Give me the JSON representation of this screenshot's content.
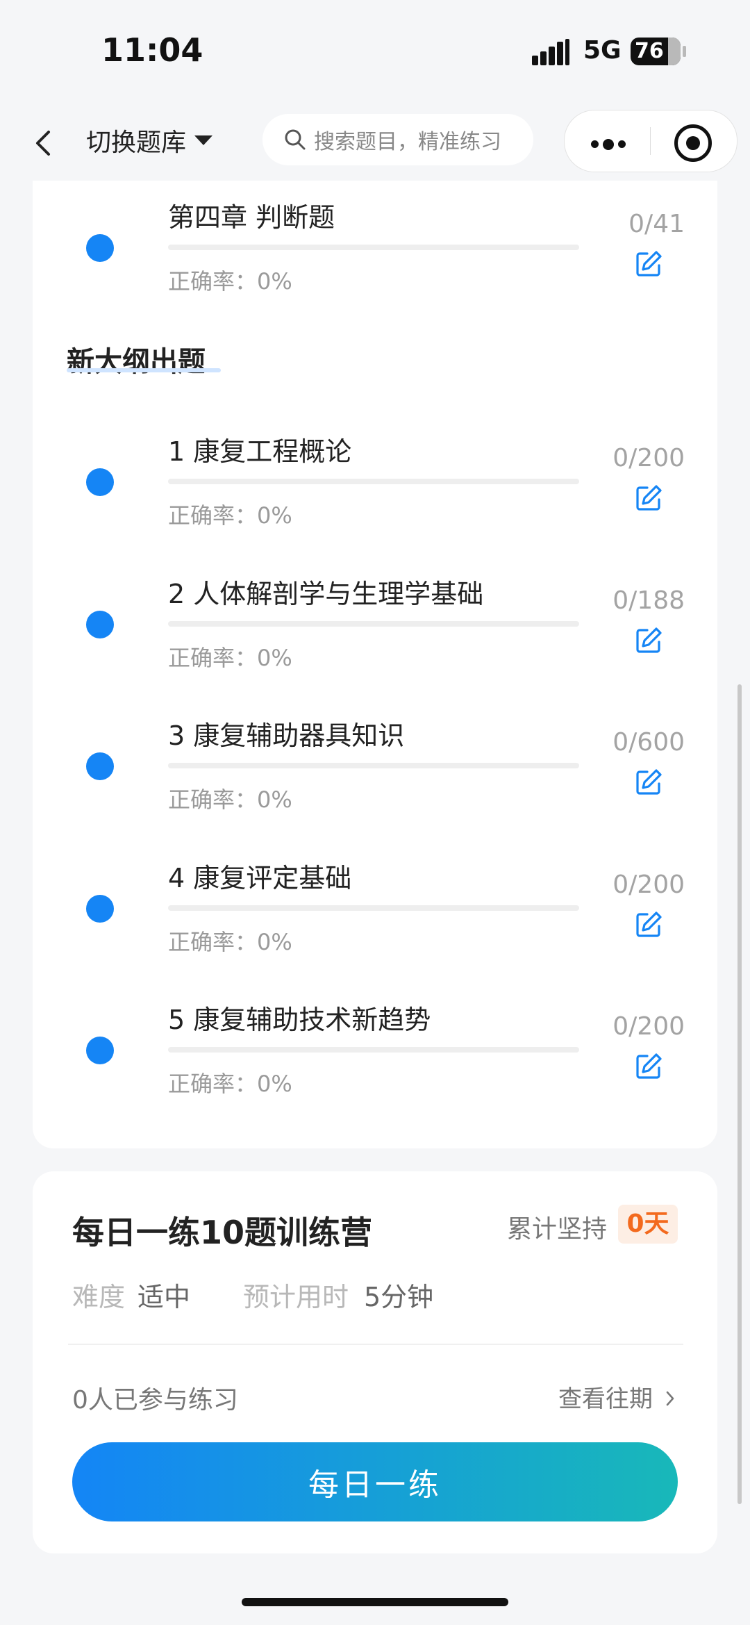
{
  "status_bar": {
    "time": "11:04",
    "network": "5G",
    "battery": "76"
  },
  "nav": {
    "switch_label": "切换题库",
    "search_placeholder": "搜索题目，精准练习"
  },
  "chapters_top": [
    {
      "title": "第四章 判断题",
      "accuracy": "正确率：0%",
      "count": "0/41"
    }
  ],
  "section": {
    "title": "新大纲出题"
  },
  "chapters": [
    {
      "title": "1 康复工程概论",
      "accuracy": "正确率：0%",
      "count": "0/200"
    },
    {
      "title": "2 人体解剖学与生理学基础",
      "accuracy": "正确率：0%",
      "count": "0/188"
    },
    {
      "title": "3 康复辅助器具知识",
      "accuracy": "正确率：0%",
      "count": "0/600"
    },
    {
      "title": "4 康复评定基础",
      "accuracy": "正确率：0%",
      "count": "0/200"
    },
    {
      "title": "5 康复辅助技术新趋势",
      "accuracy": "正确率：0%",
      "count": "0/200"
    }
  ],
  "camp": {
    "title": "每日一练10题训练营",
    "persist_label": "累计坚持",
    "persist_days": "0天",
    "difficulty_label": "难度",
    "difficulty_value": "适中",
    "time_label": "预计用时",
    "time_value": "5分钟",
    "joined": "0人已参与练习",
    "history_label": "查看往期",
    "cta_label": "每日一练"
  },
  "colors": {
    "accent": "#1585f5",
    "orange": "#f36a1e",
    "gradient_end": "#18b8b9"
  },
  "icons": [
    "back-arrow-icon",
    "caret-down-icon",
    "search-icon",
    "more-dots-icon",
    "target-icon",
    "edit-icon",
    "chevron-right-icon"
  ]
}
